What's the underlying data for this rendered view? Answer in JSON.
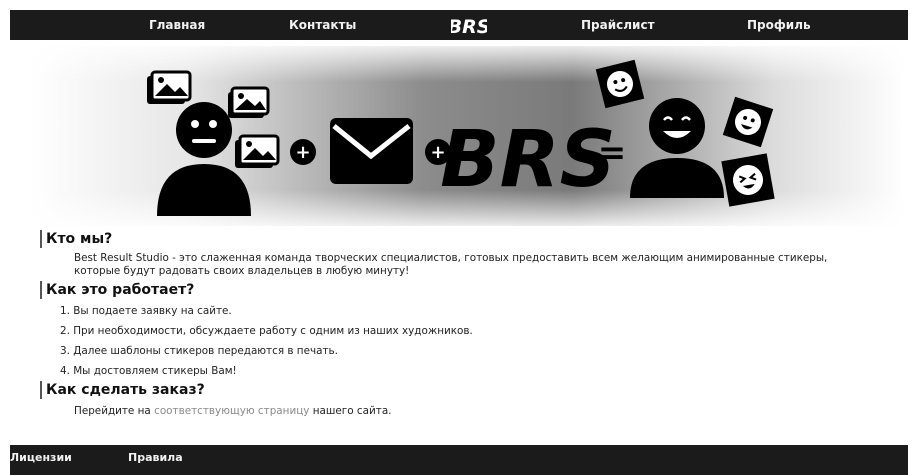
{
  "nav": {
    "home": "Главная",
    "contacts": "Контакты",
    "logo": "BRS",
    "pricelist": "Прайслист",
    "profile": "Профиль"
  },
  "banner": {
    "plus_1": "+",
    "plus_2": "+",
    "equals": "=",
    "logo_text": "BRS",
    "icons": [
      "user-neutral-icon",
      "image-icon",
      "envelope-icon",
      "plus-icon",
      "equals-icon",
      "user-happy-icon",
      "sticker-icon"
    ]
  },
  "about": {
    "title": "Кто мы?",
    "text": "Best Result Studio - это слаженная команда творческих специалистов, готовых предоставить всем желающим анимированные стикеры, которые будут радовать своих владельцев в любую минуту!"
  },
  "how": {
    "title": "Как это работает?",
    "steps": [
      "1. Вы подаете заявку на сайте.",
      "2. При необходимости, обсуждаете работу с одним из наших художников.",
      "3. Далее шаблоны стикеров передаются в печать.",
      "4. Мы достовляем стикеры Вам!"
    ]
  },
  "order": {
    "title": "Как сделать заказ?",
    "text_before": "Перейдите на",
    "link_text": "соответствующую страницу",
    "text_after": "нашего сайта."
  },
  "footer": {
    "licenses": "Лицензии",
    "rules": "Правила"
  },
  "colors": {
    "nav_bg": "#1b1b1b",
    "link": "#8a8a8a"
  }
}
